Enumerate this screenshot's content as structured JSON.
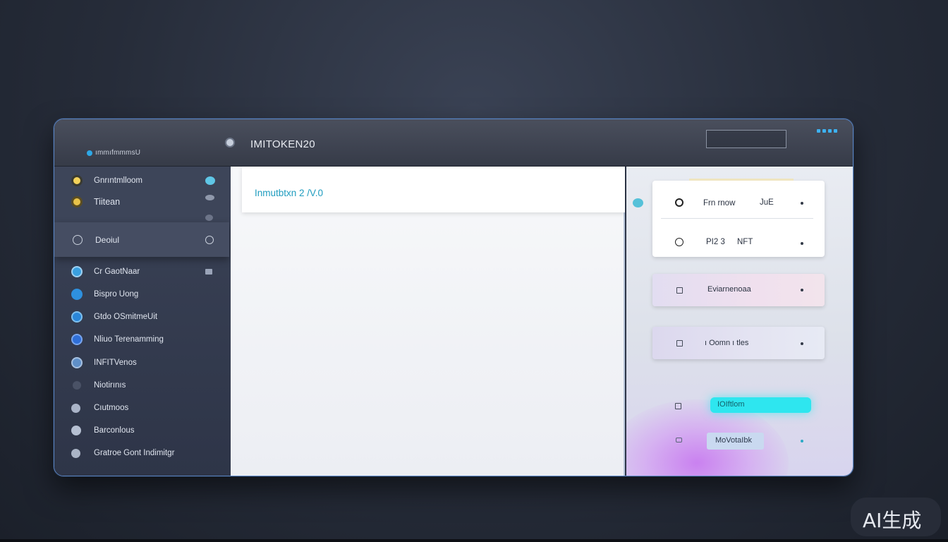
{
  "titlebar": {
    "brand_label": "ımmıfmmmsU",
    "app_title": "IMITOKEN20"
  },
  "sidebar": {
    "items": [
      {
        "label": "Gnrıntmlloom"
      },
      {
        "label": "Tiitean"
      },
      {
        "label": "Deoiul"
      },
      {
        "label": "Cr GaotNaar"
      },
      {
        "label": "Bispro Uong"
      },
      {
        "label": "Gtdo OSmitmeUit"
      },
      {
        "label": "Nliuo Terenamming"
      },
      {
        "label": "INFITVenos"
      },
      {
        "label": "Niotirınıs"
      },
      {
        "label": "Cıutmoos"
      },
      {
        "label": "Barconlous"
      },
      {
        "label": "Gratroe Gont Indimitgr"
      }
    ]
  },
  "main": {
    "title": "Inmutbtxn 2 /V.0"
  },
  "rightpanel": {
    "card1": {
      "row1_left": "Frn rnow",
      "row1_right": "JuE",
      "row2_left": "PI2 3",
      "row2_right": "NFT"
    },
    "card2_label": "Eviarnenoaa",
    "card3_label": "ı Oomn ı tles",
    "pill1_label": "IOIftlom",
    "pill2_label": "MoVotaIbk"
  },
  "watermark": "AI生成",
  "colors": {
    "accent": "#1e9cbf",
    "cyan_pill": "#2ee6ef",
    "sidebar_bg": "#2e3548",
    "window_border": "#5a85c4"
  }
}
